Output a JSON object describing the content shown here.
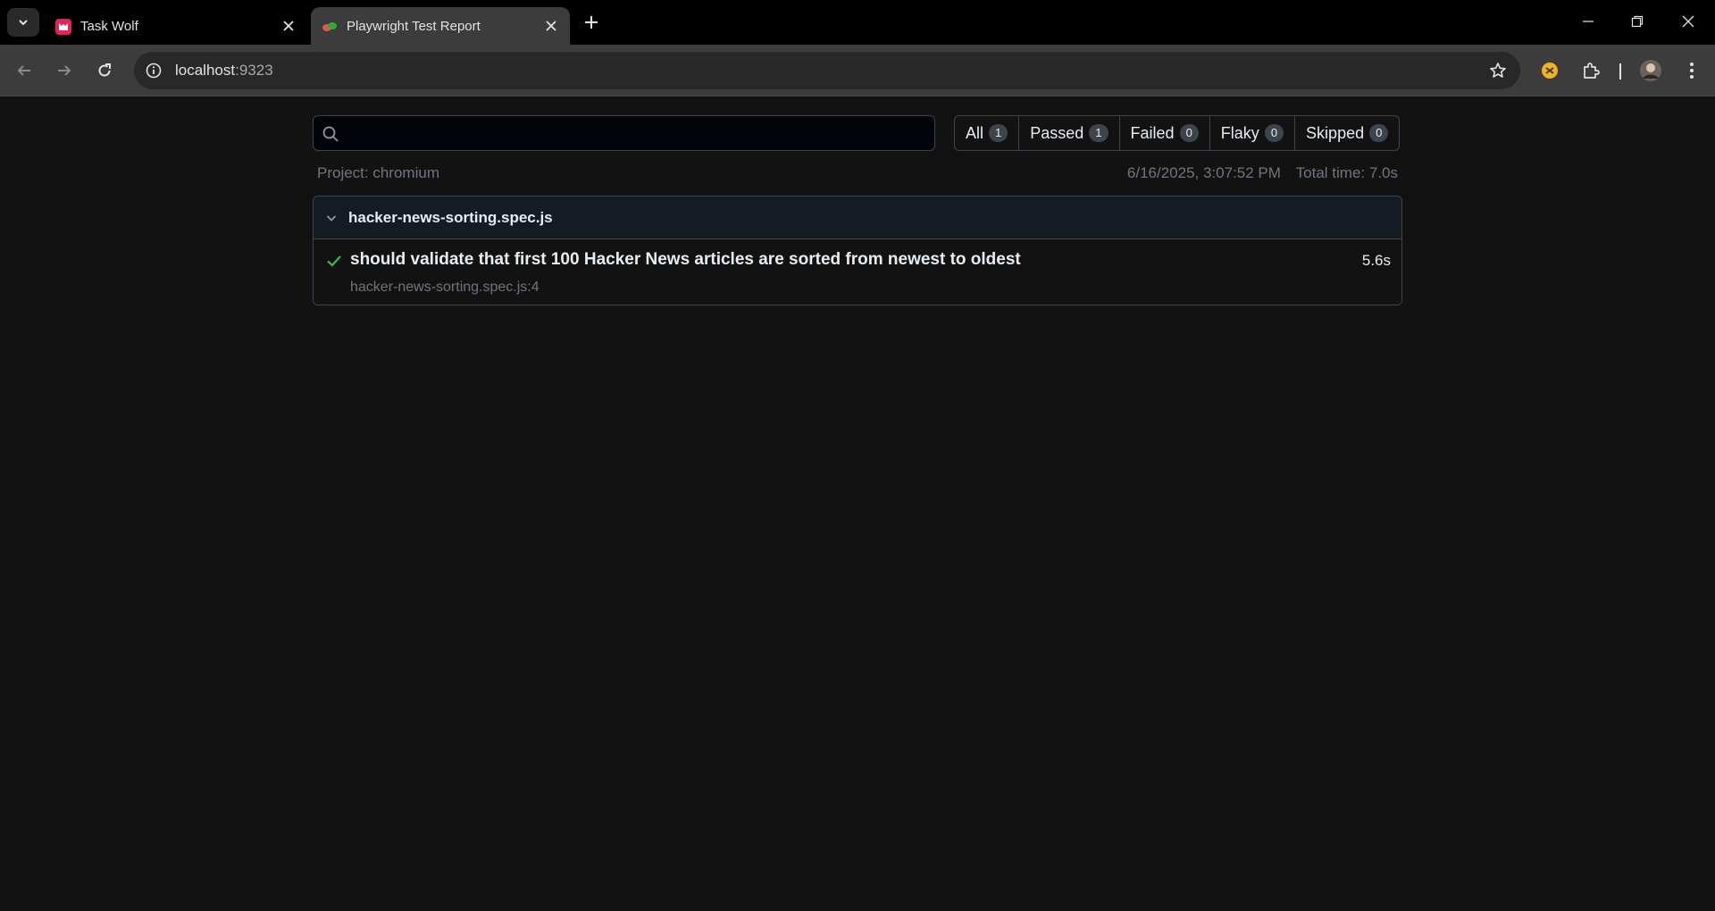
{
  "browser": {
    "tabs": [
      {
        "title": "Task Wolf",
        "active": false,
        "favicon": "task-wolf-icon"
      },
      {
        "title": "Playwright Test Report",
        "active": true,
        "favicon": "playwright-icon"
      }
    ],
    "address": {
      "host": "localhost",
      "port": ":9323"
    }
  },
  "report": {
    "search": {
      "value": "",
      "placeholder": ""
    },
    "filters": [
      {
        "label": "All",
        "count": "1"
      },
      {
        "label": "Passed",
        "count": "1"
      },
      {
        "label": "Failed",
        "count": "0"
      },
      {
        "label": "Flaky",
        "count": "0"
      },
      {
        "label": "Skipped",
        "count": "0"
      }
    ],
    "project": "Project: chromium",
    "timestamp": "6/16/2025, 3:07:52 PM",
    "total_time": "Total time: 7.0s",
    "file": {
      "name": "hacker-news-sorting.spec.js",
      "tests": [
        {
          "title": "should validate that first 100 Hacker News articles are sorted from newest to oldest",
          "location": "hacker-news-sorting.spec.js:4",
          "duration": "5.6s",
          "status": "passed"
        }
      ]
    }
  },
  "colors": {
    "page_bg": "#121212",
    "passed": "#3fb950",
    "muted": "#6e7681"
  }
}
